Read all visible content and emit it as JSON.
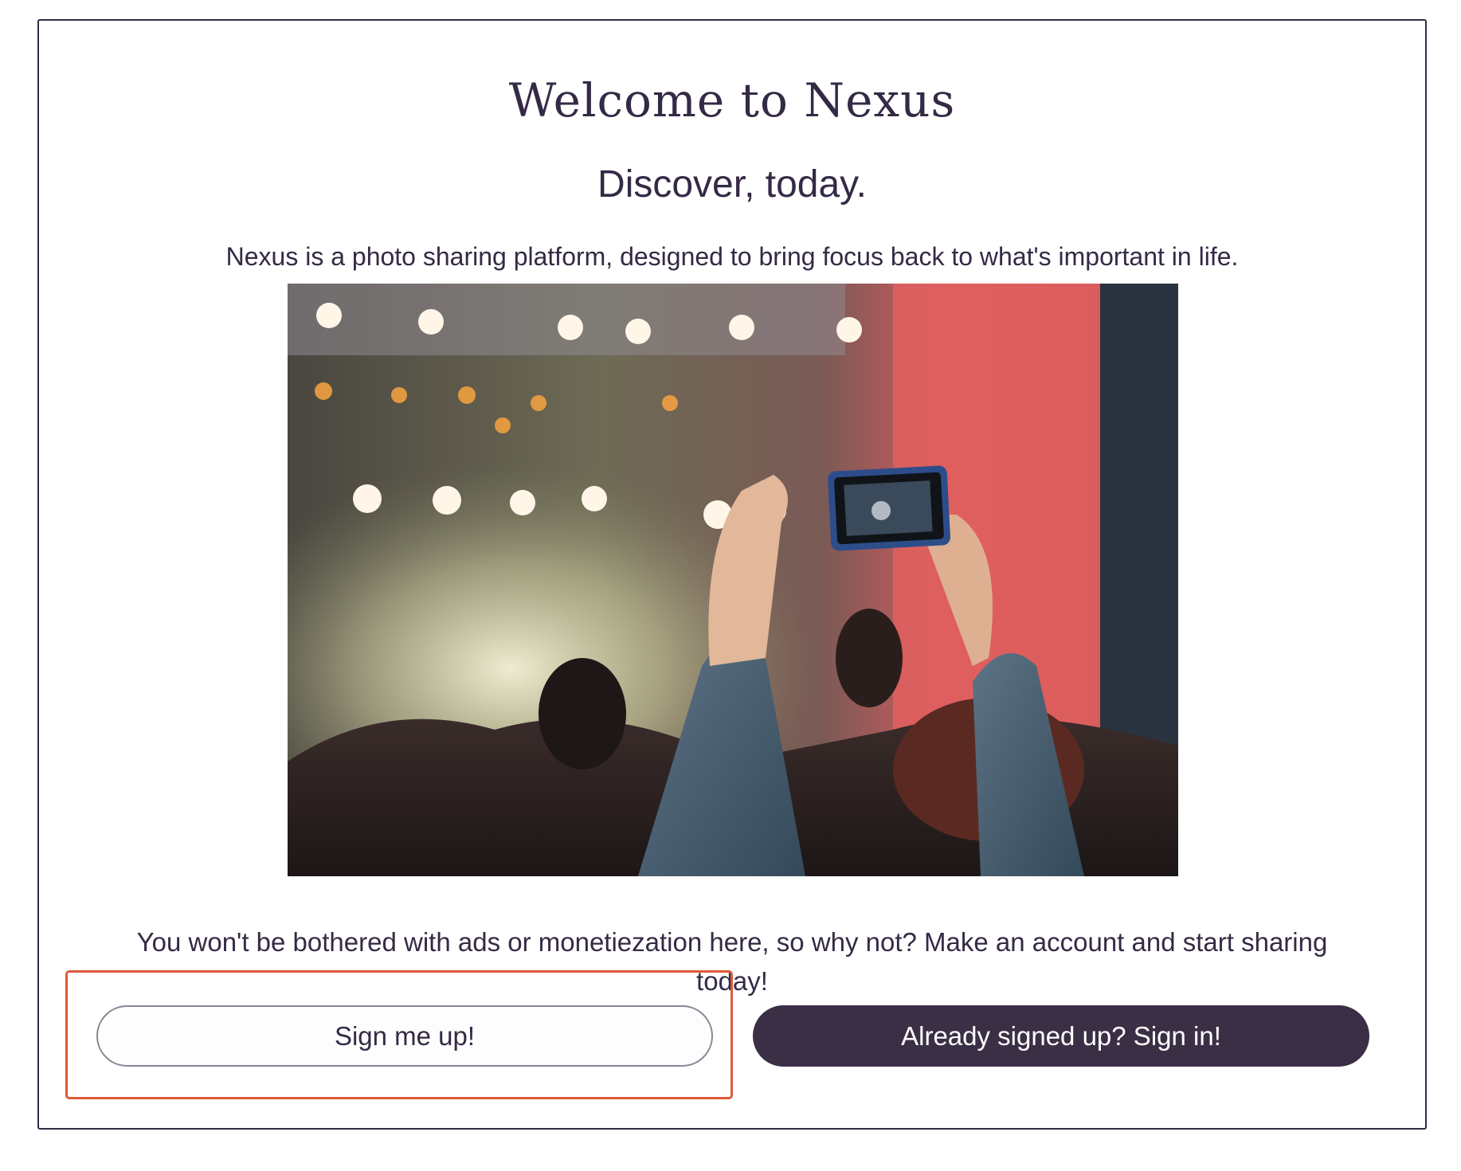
{
  "page": {
    "title": "Welcome to Nexus",
    "subtitle": "Discover, today.",
    "intro": "Nexus is a photo sharing platform, designed to bring focus back to what's important in life.",
    "cta_text": "You won't be bothered with ads or monetiezation here, so why not? Make an account and start sharing today!"
  },
  "hero_image": {
    "alt": "concert-photo"
  },
  "buttons": {
    "signup_label": "Sign me up!",
    "signin_label": "Already signed up? Sign in!"
  },
  "colors": {
    "primary": "#3b2f46",
    "text": "#352a45",
    "highlight": "#de5a3a"
  }
}
